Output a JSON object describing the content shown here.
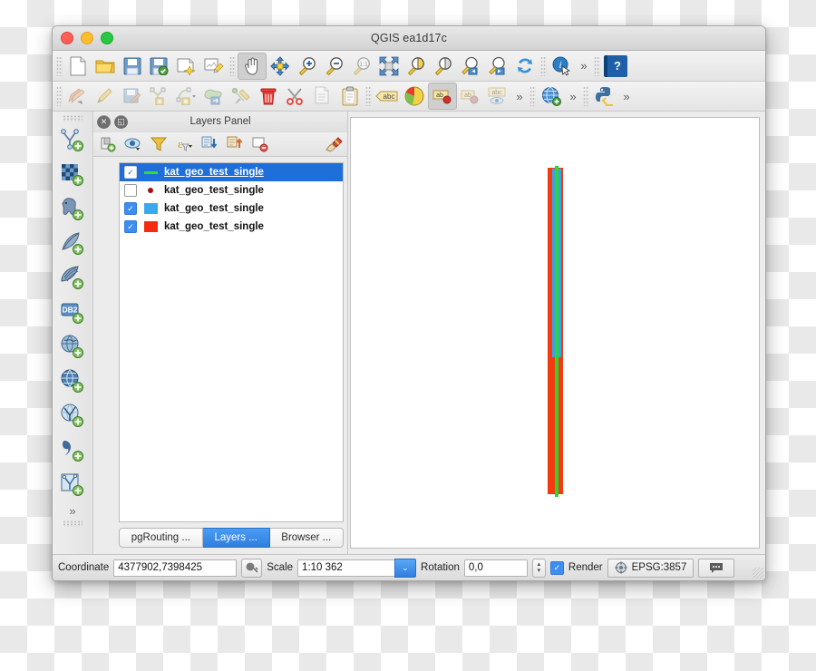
{
  "window": {
    "title": "QGIS ea1d17c",
    "traffic_lights": [
      "close-red",
      "minimize-yellow",
      "zoom-green"
    ]
  },
  "toolbar_main": {
    "items": [
      {
        "name": "new-project-icon",
        "tip": "New Project"
      },
      {
        "name": "open-project-icon",
        "tip": "Open Project"
      },
      {
        "name": "save-project-icon",
        "tip": "Save Project"
      },
      {
        "name": "save-project-as-icon",
        "tip": "Save Project As"
      },
      {
        "name": "new-print-composer-icon",
        "tip": "New Print Composer"
      },
      {
        "name": "composer-manager-icon",
        "tip": "Composer Manager"
      },
      {
        "name": "pan-map-icon",
        "tip": "Pan Map",
        "active": true
      },
      {
        "name": "pan-to-selection-icon",
        "tip": "Pan Map to Selection"
      },
      {
        "name": "zoom-in-icon",
        "tip": "Zoom In"
      },
      {
        "name": "zoom-out-icon",
        "tip": "Zoom Out"
      },
      {
        "name": "zoom-native-icon",
        "tip": "Zoom to Native Resolution (1:1)"
      },
      {
        "name": "zoom-full-icon",
        "tip": "Zoom Full"
      },
      {
        "name": "zoom-to-selection-icon",
        "tip": "Zoom to Selection"
      },
      {
        "name": "zoom-to-layer-icon",
        "tip": "Zoom to Layer"
      },
      {
        "name": "zoom-last-icon",
        "tip": "Zoom Last"
      },
      {
        "name": "zoom-next-icon",
        "tip": "Zoom Next"
      },
      {
        "name": "refresh-icon",
        "tip": "Refresh"
      },
      {
        "name": "identify-features-icon",
        "tip": "Identify Features"
      }
    ],
    "overflow_label": "»",
    "help_label": "?"
  },
  "toolbar_digitizing": {
    "items": [
      {
        "name": "current-edits-icon",
        "tip": "Current Edits"
      },
      {
        "name": "toggle-editing-icon",
        "tip": "Toggle Editing"
      },
      {
        "name": "save-layer-edits-icon",
        "tip": "Save Layer Edits"
      },
      {
        "name": "add-feature-icon",
        "tip": "Add Feature"
      },
      {
        "name": "add-circular-string-icon",
        "tip": "Add Circular String"
      },
      {
        "name": "move-feature-icon",
        "tip": "Move Feature"
      },
      {
        "name": "node-tool-icon",
        "tip": "Node Tool"
      },
      {
        "name": "delete-selected-icon",
        "tip": "Delete Selected"
      },
      {
        "name": "cut-features-icon",
        "tip": "Cut Features"
      },
      {
        "name": "copy-features-icon",
        "tip": "Copy Features"
      },
      {
        "name": "paste-features-icon",
        "tip": "Paste Features"
      }
    ],
    "label_items": [
      {
        "name": "show-labels-icon",
        "tip": "Layer Labeling Options"
      },
      {
        "name": "diagram-properties-icon",
        "tip": "Diagram Properties"
      },
      {
        "name": "move-label-icon",
        "tip": "Move Label or Diagram",
        "active": true
      },
      {
        "name": "rotate-label-icon",
        "tip": "Rotate Label"
      },
      {
        "name": "change-label-icon",
        "tip": "Change Label"
      }
    ],
    "web_items": [
      {
        "name": "metasearch-icon",
        "tip": "MetaSearch"
      }
    ],
    "plugin_items": [
      {
        "name": "python-console-icon",
        "tip": "Python Console"
      }
    ],
    "overflow_label": "»"
  },
  "left_toolbar": {
    "items": [
      {
        "name": "add-vector-layer-icon",
        "tip": "Add Vector Layer"
      },
      {
        "name": "add-raster-layer-icon",
        "tip": "Add Raster Layer"
      },
      {
        "name": "add-postgis-layer-icon",
        "tip": "Add PostGIS Layer"
      },
      {
        "name": "add-spatialite-layer-icon",
        "tip": "Add SpatiaLite Layer"
      },
      {
        "name": "add-mssql-layer-icon",
        "tip": "Add MSSQL Spatial Layer"
      },
      {
        "name": "add-db2-layer-icon",
        "tip": "Add DB2 Spatial Layer"
      },
      {
        "name": "add-wms-layer-icon",
        "tip": "Add WMS/WMTS Layer"
      },
      {
        "name": "add-wcs-layer-icon",
        "tip": "Add WCS Layer"
      },
      {
        "name": "add-wfs-layer-icon",
        "tip": "Add WFS Layer"
      },
      {
        "name": "add-delimited-text-layer-icon",
        "tip": "Add Delimited Text Layer"
      },
      {
        "name": "add-virtual-layer-icon",
        "tip": "Add Virtual Layer"
      }
    ],
    "overflow_label": "»"
  },
  "layers_panel": {
    "title": "Layers Panel",
    "close_label": "✕",
    "float_label": "◱",
    "toolbar": [
      {
        "name": "add-group-icon",
        "tip": "Add Group"
      },
      {
        "name": "manage-layer-visibility-icon",
        "tip": "Manage Layer Visibility"
      },
      {
        "name": "filter-legend-icon",
        "tip": "Filter Legend by Map Content"
      },
      {
        "name": "filter-legend-expression-icon",
        "tip": "Filter Legend by Expression"
      },
      {
        "name": "collapse-all-icon",
        "tip": "Collapse All"
      },
      {
        "name": "expand-all-icon",
        "tip": "Expand All"
      },
      {
        "name": "remove-layer-icon",
        "tip": "Remove Layer/Group"
      },
      {
        "name": "open-layer-styling-icon",
        "tip": "Open the Layer Styling panel"
      }
    ],
    "layers": [
      {
        "name": "kat_geo_test_single",
        "checked": true,
        "selected": true,
        "symbol": "line",
        "color": "#3ad93a"
      },
      {
        "name": "kat_geo_test_single",
        "checked": false,
        "selected": false,
        "symbol": "point",
        "color": "#9e1414"
      },
      {
        "name": "kat_geo_test_single",
        "checked": true,
        "selected": false,
        "symbol": "polygon",
        "color": "#3aa9ec"
      },
      {
        "name": "kat_geo_test_single",
        "checked": true,
        "selected": false,
        "symbol": "polygon",
        "color": "#f42b0c"
      }
    ],
    "tabs": [
      {
        "label": "pgRouting ...",
        "active": false
      },
      {
        "label": "Layers ...",
        "active": true
      },
      {
        "label": "Browser ...",
        "active": false
      }
    ]
  },
  "map_canvas": {
    "background": "#ffffff",
    "features": [
      {
        "name": "red-polygon-feature",
        "color": "#f33b10"
      },
      {
        "name": "blue-polygon-feature",
        "color": "#3aa3e8"
      },
      {
        "name": "green-line-feature",
        "color": "#2fd62f"
      }
    ]
  },
  "status_bar": {
    "coordinate_label": "Coordinate",
    "coordinate_value": "4377902,7398425",
    "coordinate_toggle_icon": "extents-toggle-icon",
    "scale_label": "Scale",
    "scale_value": "1:10 362",
    "scale_dropdown_label": "⌄",
    "rotation_label": "Rotation",
    "rotation_value": "0,0",
    "spinner_up": "▴",
    "spinner_down": "▾",
    "render_label": "Render",
    "render_checked": true,
    "crs_label": "EPSG:3857",
    "crs_icon": "crs-status-icon",
    "messages_icon": "messages-bubble-icon"
  }
}
